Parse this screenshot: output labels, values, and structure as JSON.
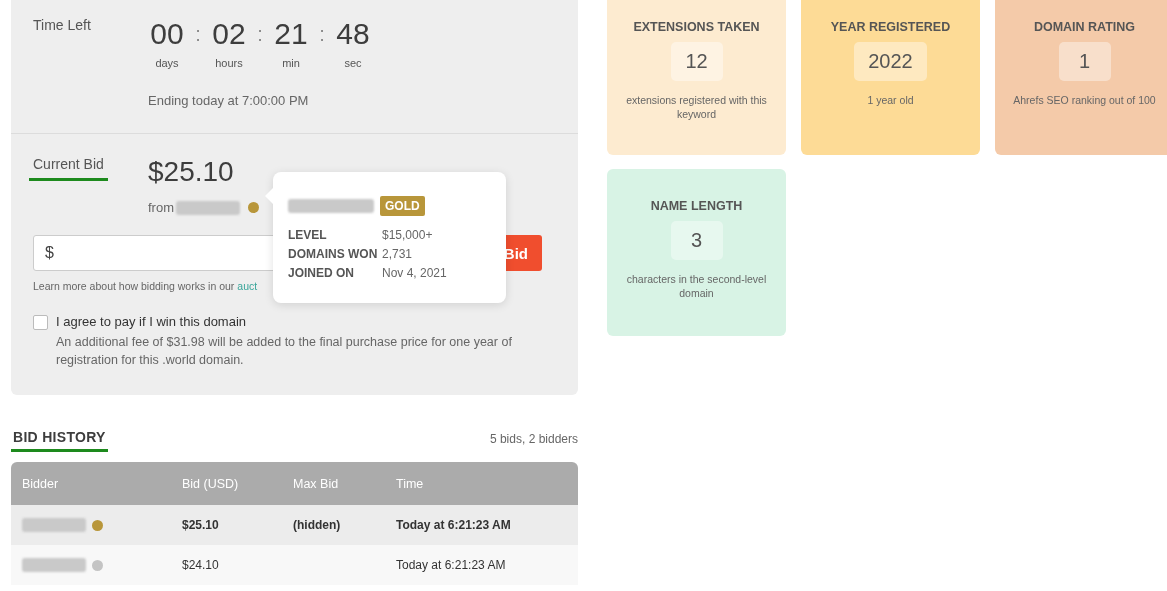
{
  "time_left": {
    "label": "Time Left",
    "units": [
      {
        "value": "00",
        "unit": "days"
      },
      {
        "value": "02",
        "unit": "hours"
      },
      {
        "value": "21",
        "unit": "min"
      },
      {
        "value": "48",
        "unit": "sec"
      }
    ],
    "separator": ":",
    "ending": "Ending today at 7:00:00 PM"
  },
  "current_bid": {
    "label": "Current Bid",
    "amount": "$25.10",
    "from": "from"
  },
  "bid_form": {
    "placeholder": "$",
    "button": "Bid",
    "learn_more": "Learn more about how bidding works in our ",
    "learn_more_link": "auct",
    "agree": {
      "label": "I agree to pay if I win this domain",
      "checked": false
    },
    "fee_note": "An additional fee of $31.98 will be added to the final purchase price for one year of registration for this .world domain."
  },
  "tooltip": {
    "badge": "GOLD",
    "rows": [
      {
        "label": "LEVEL",
        "value": "$15,000+"
      },
      {
        "label": "DOMAINS WON",
        "value": "2,731"
      },
      {
        "label": "JOINED ON",
        "value": "Nov 4, 2021"
      }
    ]
  },
  "bid_history": {
    "title": "BID HISTORY",
    "summary": "5 bids, 2 bidders",
    "columns": [
      "Bidder",
      "Bid (USD)",
      "Max Bid",
      "Time"
    ],
    "rows": [
      {
        "color": "#b8963a",
        "top_bid": true,
        "bid": "$25.10",
        "max_bid": "(hidden)",
        "time": "Today at 6:21:23 AM"
      },
      {
        "color": "#c4c4c4",
        "top_bid": false,
        "bid": "$24.10",
        "time": "Today at 6:21:23 AM"
      }
    ]
  },
  "stats": [
    {
      "title": "EXTENSIONS TAKEN",
      "value": "12",
      "note": "extensions registered with this keyword",
      "color": "#fdebd0"
    },
    {
      "title": "YEAR REGISTERED",
      "value": "2022",
      "note": "1 year old",
      "color": "#fddb96"
    },
    {
      "title": "DOMAIN RATING",
      "value": "1",
      "note": "Ahrefs SEO ranking out of 100",
      "color": "#f4caa9"
    },
    {
      "title": "NAME LENGTH",
      "value": "3",
      "note": "characters in the second-level domain",
      "color": "#d8f3e5"
    }
  ]
}
